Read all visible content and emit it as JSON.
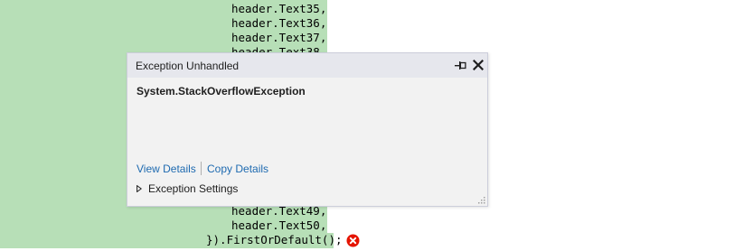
{
  "code": {
    "lines": [
      "header.Text35,",
      "header.Text36,",
      "header.Text37,",
      "header.Text38",
      "header.Text49,",
      "header.Text50,",
      "}).FirstOrDefault();"
    ]
  },
  "popup": {
    "title": "Exception Unhandled",
    "exception_type": "System.StackOverflowException",
    "view_details_label": "View Details",
    "copy_details_label": "Copy Details",
    "settings_label": "Exception Settings",
    "icons": [
      "pin-icon",
      "close-icon",
      "expand-triangle-icon",
      "resize-grip-icon"
    ]
  },
  "error_glyph": {
    "icon": "error-circle-icon",
    "color": "#e51400"
  },
  "colors": {
    "highlight": "#b7dfb7",
    "link": "#1e6ab0",
    "popup_bg": "#f2f2f2",
    "popup_header": "#e6e7ed"
  }
}
